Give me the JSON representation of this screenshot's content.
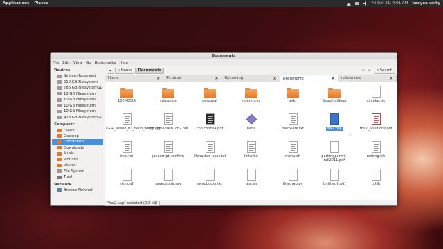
{
  "top_panel": {
    "menus": [
      "Applications",
      "Places"
    ],
    "clock": "Fri Oct 21, 4:01 AM",
    "user": "heoyea-unity"
  },
  "window": {
    "title": "Documents",
    "menu": [
      "File",
      "Edit",
      "View",
      "Go",
      "Bookmarks",
      "Help"
    ]
  },
  "sidebar": {
    "devices_header": "Devices",
    "devices": [
      {
        "label": "System Reserved",
        "eject": false
      },
      {
        "label": "210 GB Filesystem",
        "eject": false
      },
      {
        "label": "786 GB Filesystem",
        "eject": true
      },
      {
        "label": "10 GB Filesystem",
        "eject": false
      },
      {
        "label": "10 GB Filesystem",
        "eject": false
      },
      {
        "label": "10 GB Filesystem",
        "eject": false
      },
      {
        "label": "10 GB Filesystem",
        "eject": false
      },
      {
        "label": "418 GB Filesystem",
        "eject": true
      }
    ],
    "computer_header": "Computer",
    "computer": [
      "Home",
      "Desktop",
      "Documents",
      "Downloads",
      "Music",
      "Pictures",
      "Videos",
      "File System",
      "Trash"
    ],
    "network_header": "Network",
    "network": [
      "Browse Network"
    ]
  },
  "pathbar": {
    "home": "Home",
    "current": "Documents",
    "search": "Search"
  },
  "tabs": [
    "Home",
    "Pictures",
    "Upcoming",
    "Documents",
    "references"
  ],
  "files": [
    {
      "name": "100MEDIA",
      "type": "folder"
    },
    {
      "name": "cplusplus",
      "type": "folder"
    },
    {
      "name": "personal",
      "type": "folder"
    },
    {
      "name": "references",
      "type": "folder"
    },
    {
      "name": "wiki",
      "type": "folder"
    },
    {
      "name": "BeautifulSoup",
      "type": "folder"
    },
    {
      "name": "circular.txt",
      "type": "doc"
    },
    {
      "name": "c++_lesson_01_hello_world.cpp",
      "type": "doc"
    },
    {
      "name": "cpp.Appendch1ch2.pdf",
      "type": "doc"
    },
    {
      "name": "cpp.ch3ch4.pdf",
      "type": "dark"
    },
    {
      "name": "haha",
      "type": "diamond"
    },
    {
      "name": "hardware.txt",
      "type": "doc"
    },
    {
      "name": "hw2.cpp",
      "type": "blue",
      "selected": true
    },
    {
      "name": "HW1_Solutions.pdf",
      "type": "pink"
    },
    {
      "name": "irssi.txt",
      "type": "doc"
    },
    {
      "name": "javascript_confirm",
      "type": "doc"
    },
    {
      "name": "lifehacker_pass.txt",
      "type": "doc"
    },
    {
      "name": "links.txt",
      "type": "doc"
    },
    {
      "name": "menu.sh",
      "type": "doc"
    },
    {
      "name": "parkingpermit-fall2011.pdf",
      "type": "blank"
    },
    {
      "name": "rooting.txt",
      "type": "doc"
    },
    {
      "name": "rtm.pdf",
      "type": "doc"
    },
    {
      "name": "savedstate.sav",
      "type": "doc"
    },
    {
      "name": "swagbucks.txt",
      "type": "doc"
    },
    {
      "name": "test.sh",
      "type": "doc"
    },
    {
      "name": "titlegrab.py",
      "type": "doc"
    },
    {
      "name": "Untitled0.pdf",
      "type": "doc"
    },
    {
      "name": "urllib",
      "type": "doc"
    }
  ],
  "status": "\"hw2.cpp\" selected (2.3 kB)",
  "colors": {
    "selection": "#4a90d9",
    "folder": "#e2772c"
  }
}
